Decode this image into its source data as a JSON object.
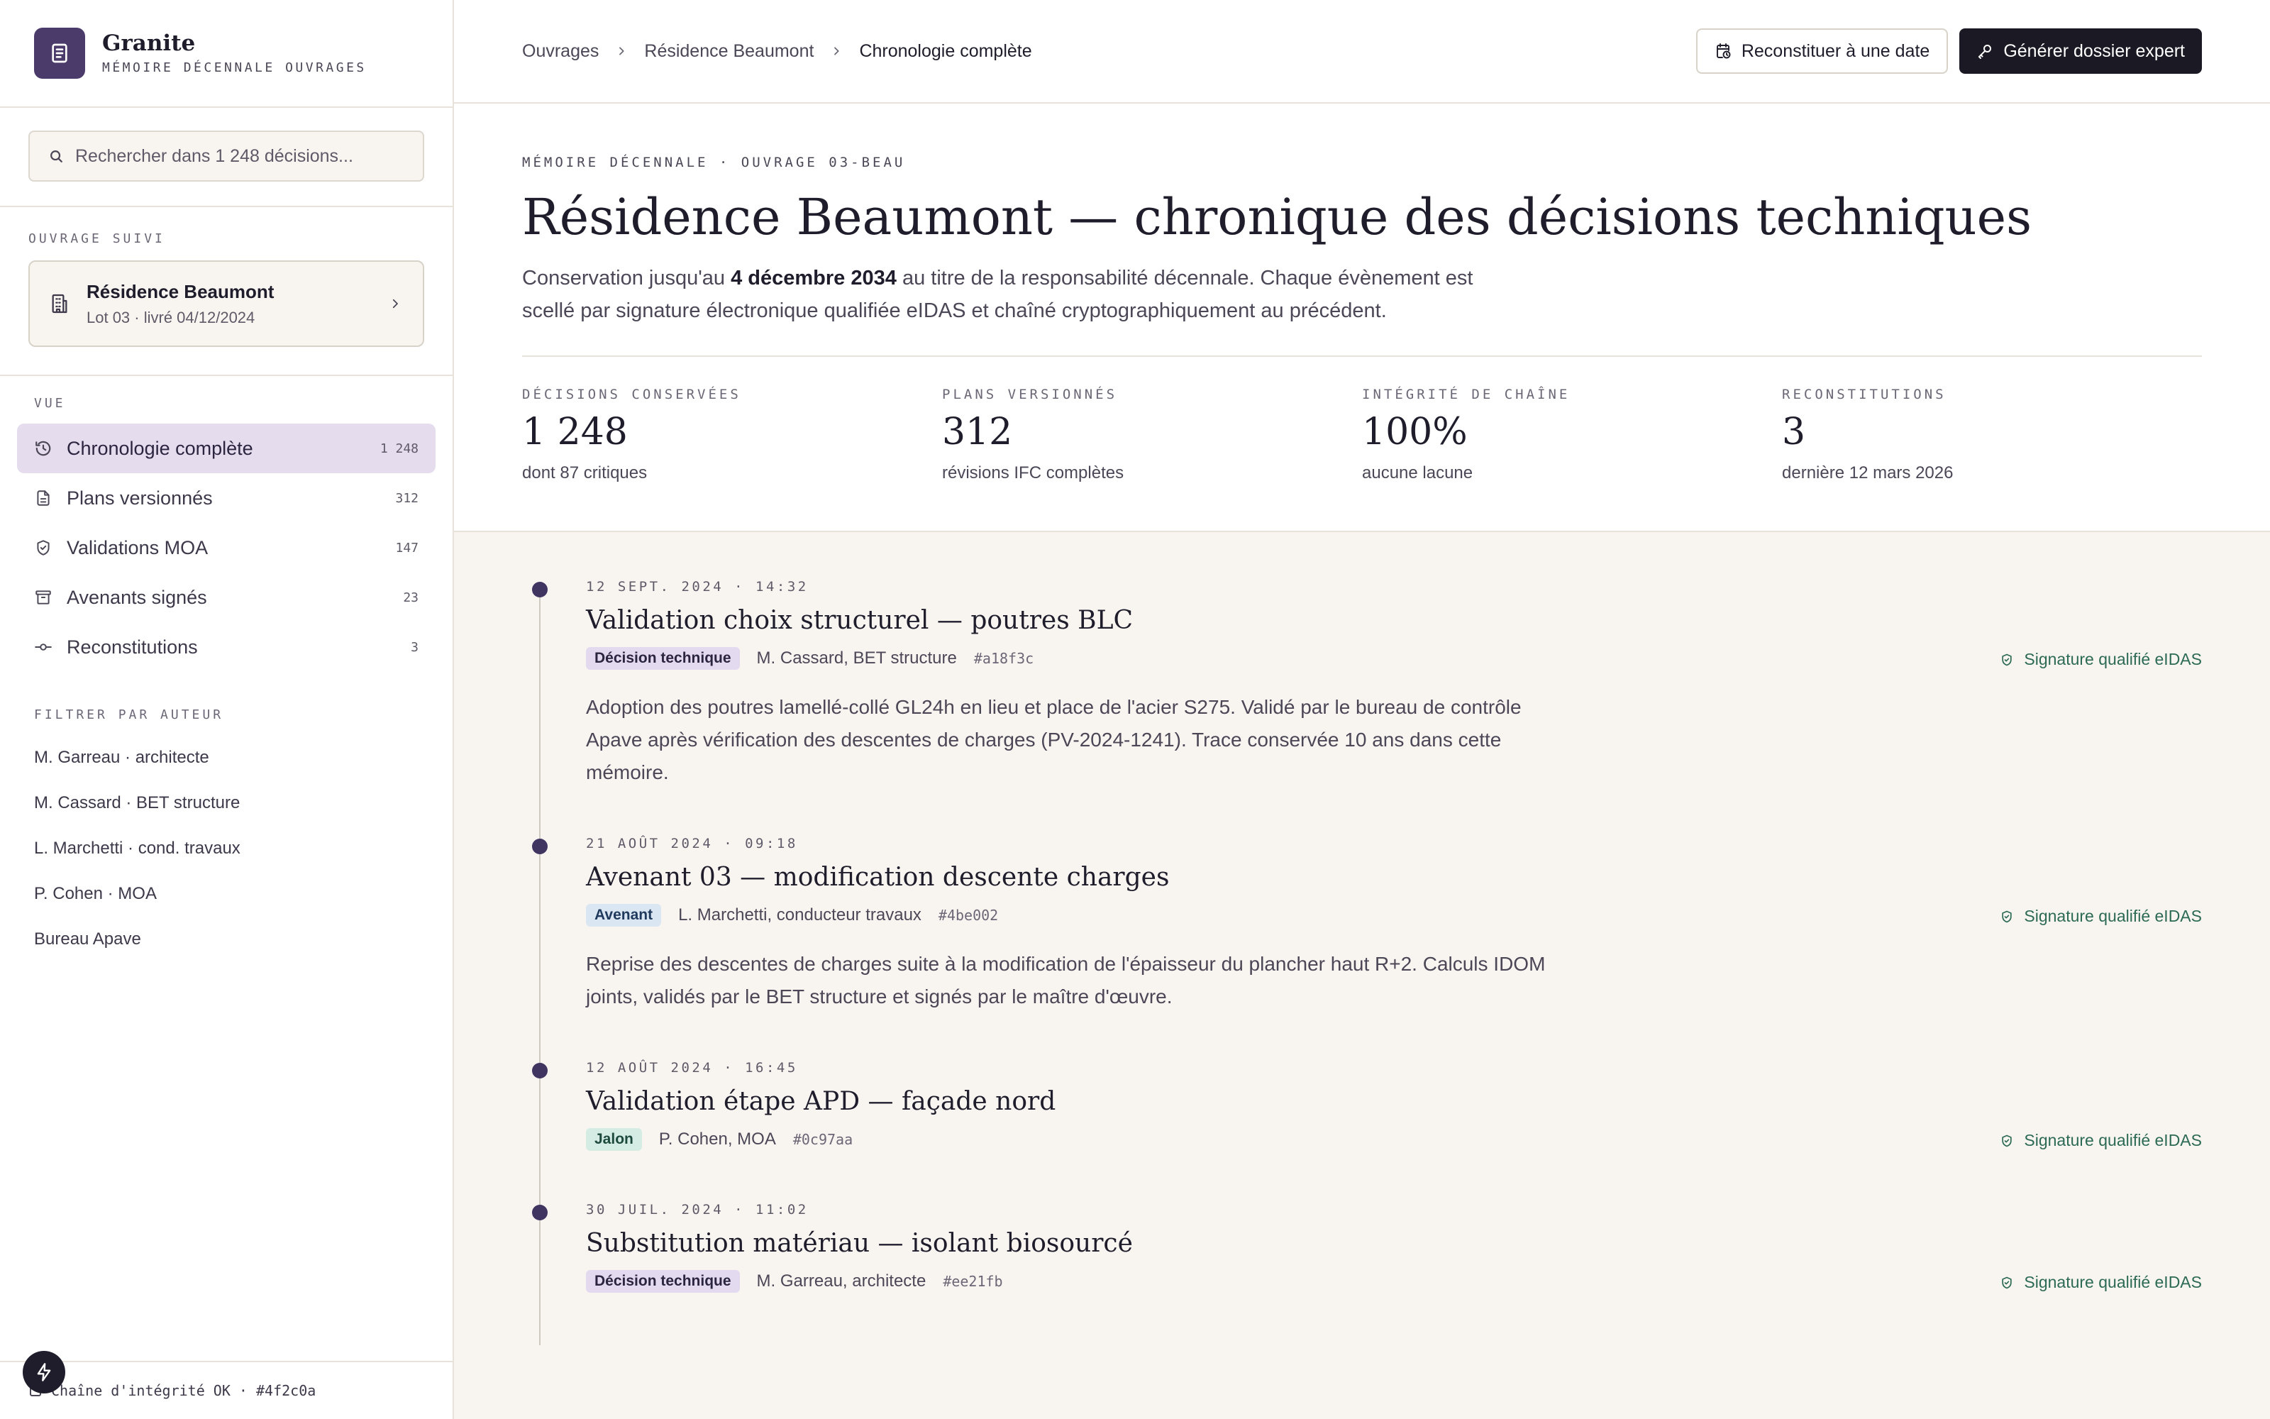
{
  "brand": {
    "name": "Granite",
    "subtitle": "MÉMOIRE DÉCENNALE OUVRAGES"
  },
  "search": {
    "placeholder": "Rechercher dans 1 248 décisions..."
  },
  "followed": {
    "section_label": "OUVRAGE SUIVI",
    "title": "Résidence Beaumont",
    "subtitle": "Lot 03 · livré 04/12/2024"
  },
  "nav": {
    "section_label": "VUE",
    "items": [
      {
        "label": "Chronologie complète",
        "count": "1 248",
        "icon": "history-icon",
        "active": true
      },
      {
        "label": "Plans versionnés",
        "count": "312",
        "icon": "document-icon",
        "active": false
      },
      {
        "label": "Validations MOA",
        "count": "147",
        "icon": "shield-check-icon",
        "active": false
      },
      {
        "label": "Avenants signés",
        "count": "23",
        "icon": "archive-icon",
        "active": false
      },
      {
        "label": "Reconstitutions",
        "count": "3",
        "icon": "commit-icon",
        "active": false
      }
    ]
  },
  "authors": {
    "section_label": "FILTRER PAR AUTEUR",
    "items": [
      "M. Garreau · architecte",
      "M. Cassard · BET structure",
      "L. Marchetti · cond. travaux",
      "P. Cohen · MOA",
      "Bureau Apave"
    ]
  },
  "footer": {
    "status": "Chaîne d'intégrité OK · #4f2c0a"
  },
  "breadcrumb": {
    "items": [
      "Ouvrages",
      "Résidence Beaumont"
    ],
    "current": "Chronologie complète"
  },
  "actions": {
    "reconstruct": "Reconstituer à une date",
    "generate": "Générer dossier expert"
  },
  "header": {
    "eyebrow": "MÉMOIRE DÉCENNALE · OUVRAGE 03-BEAU",
    "title": "Résidence Beaumont — chronique des décisions techniques",
    "lede_before": "Conservation jusqu'au ",
    "lede_bold": "4 décembre 2034",
    "lede_after": " au titre de la responsabilité décennale. Chaque évènement est scellé par signature électronique qualifiée eIDAS et chaîné cryptographiquement au précédent."
  },
  "stats": [
    {
      "label": "DÉCISIONS CONSERVÉES",
      "value": "1 248",
      "sub": "dont 87 critiques"
    },
    {
      "label": "PLANS VERSIONNÉS",
      "value": "312",
      "sub": "révisions IFC complètes"
    },
    {
      "label": "INTÉGRITÉ DE CHAÎNE",
      "value": "100%",
      "sub": "aucune lacune"
    },
    {
      "label": "RECONSTITUTIONS",
      "value": "3",
      "sub": "dernière 12 mars 2026"
    }
  ],
  "events": [
    {
      "date": "12 SEPT. 2024 · 14:32",
      "title": "Validation choix structurel — poutres BLC",
      "tag": "Décision technique",
      "author": "M. Cassard, BET structure",
      "hash": "#a18f3c",
      "signature": "Signature qualifié eIDAS",
      "body": "Adoption des poutres lamellé-collé GL24h en lieu et place de l'acier S275. Validé par le bureau de contrôle Apave après vérification des descentes de charges (PV-2024-1241). Trace conservée 10 ans dans cette mémoire."
    },
    {
      "date": "21 AOÛT 2024 · 09:18",
      "title": "Avenant 03 — modification descente charges",
      "tag": "Avenant",
      "author": "L. Marchetti, conducteur travaux",
      "hash": "#4be002",
      "signature": "Signature qualifié eIDAS",
      "body": "Reprise des descentes de charges suite à la modification de l'épaisseur du plancher haut R+2. Calculs IDOM joints, validés par le BET structure et signés par le maître d'œuvre."
    },
    {
      "date": "12 AOÛT 2024 · 16:45",
      "title": "Validation étape APD — façade nord",
      "tag": "Jalon",
      "author": "P. Cohen, MOA",
      "hash": "#0c97aa",
      "signature": "Signature qualifié eIDAS",
      "body": ""
    },
    {
      "date": "30 JUIL. 2024 · 11:02",
      "title": "Substitution matériau — isolant biosourcé",
      "tag": "Décision technique",
      "author": "M. Garreau, architecte",
      "hash": "#ee21fb",
      "signature": "Signature qualifié eIDAS",
      "body": ""
    }
  ],
  "colors": {
    "brand": "#4a3b6b",
    "active_nav": "#e5dcee",
    "signature": "#2d6a55",
    "dark_button": "#1b1a24",
    "timeline_bg": "#f8f5f1"
  }
}
